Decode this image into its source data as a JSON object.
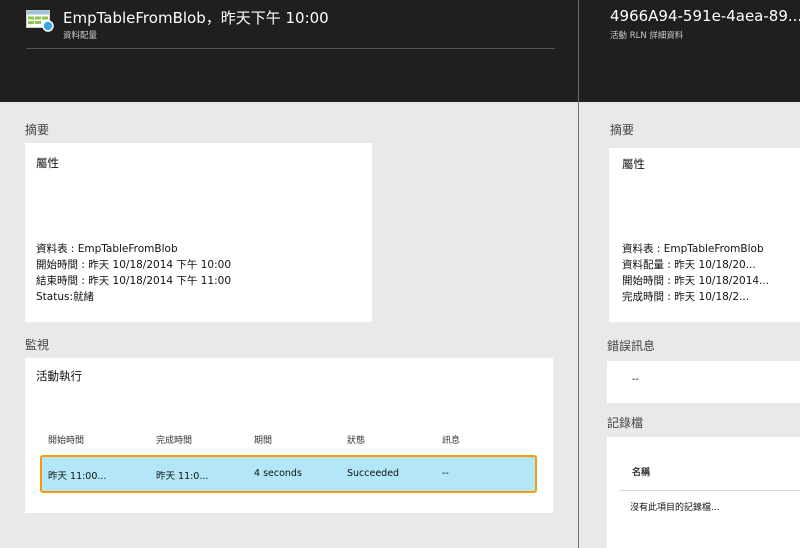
{
  "left_blade": {
    "title": "EmpTableFromBlob，昨天下午 10:00",
    "subtitle": "資料配量",
    "summary_label": "摘要",
    "properties": {
      "title": "屬性",
      "lines": [
        "資料表 : EmpTableFromBlob",
        "開始時間 : 昨天 10/18/2014 下午 10:00",
        "結束時間 : 昨天 10/18/2014 下午 11:00",
        "Status:就緒"
      ]
    },
    "monitor_label": "監視",
    "activity_runs": {
      "title": "活動執行",
      "columns": [
        "開始時間",
        "完成時間",
        "期間",
        "狀態",
        "訊息"
      ],
      "rows": [
        [
          "昨天 11:00...",
          "昨天 11:0...",
          "4 seconds",
          "Succeeded",
          "--"
        ]
      ]
    }
  },
  "right_blade": {
    "title": "4966A94-591e-4aea-89...",
    "subtitle": "活動 RLN 詳細資料",
    "summary_label": "摘要",
    "properties": {
      "title": "屬性",
      "lines": [
        "資料表 : EmpTableFromBlob",
        "資料配量 : 昨天 10/18/20...",
        "開始時間 : 昨天 10/18/2014...",
        "完成時間 : 昨天 10/18/2..."
      ]
    },
    "errors_label": "錯誤訊息",
    "errors_value": "--",
    "logs_label": "記錄檔",
    "logs_column": "名稱",
    "logs_empty": "沒有此項目的記錄檔..."
  },
  "colors": {
    "header_bg": "#1f1f1f",
    "panel_bg": "#e8e9e8",
    "selected_row": "#b3e6f6",
    "highlight_border": "#f39c12",
    "icon_accent": "#3aa8de"
  },
  "icons": [
    "table-icon",
    "status-dot-icon"
  ]
}
